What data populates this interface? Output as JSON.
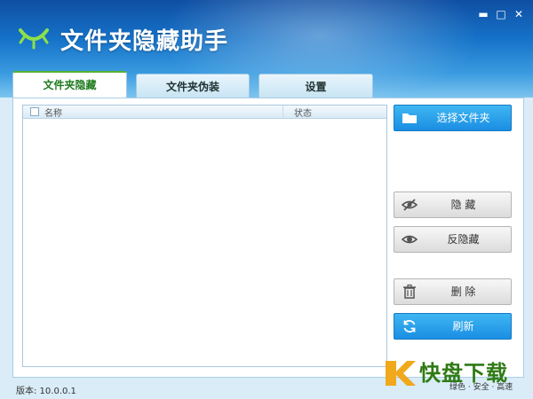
{
  "app": {
    "title": "文件夹隐藏助手"
  },
  "window_controls": {
    "minimize": "▬",
    "maximize": "□",
    "close": "✕"
  },
  "tabs": [
    {
      "label": "文件夹隐藏",
      "active": true
    },
    {
      "label": "文件夹伪装",
      "active": false
    },
    {
      "label": "设置",
      "active": false
    }
  ],
  "list": {
    "columns": [
      "名称",
      "状态"
    ],
    "rows": []
  },
  "buttons": {
    "select_folder": "选择文件夹",
    "hide": "隐 藏",
    "unhide": "反隐藏",
    "delete": "删 除",
    "refresh": "刷新"
  },
  "status_bar": {
    "version": "版本: 10.0.0.1"
  },
  "watermark": {
    "brand_char": "快",
    "brand_rest": "盘下载",
    "tagline": "绿色 · 安全 · 高速"
  },
  "colors": {
    "accent_blue": "#1a8ee3",
    "tab_active_text": "#1f7a1f",
    "header_blue": "#1572c8"
  }
}
